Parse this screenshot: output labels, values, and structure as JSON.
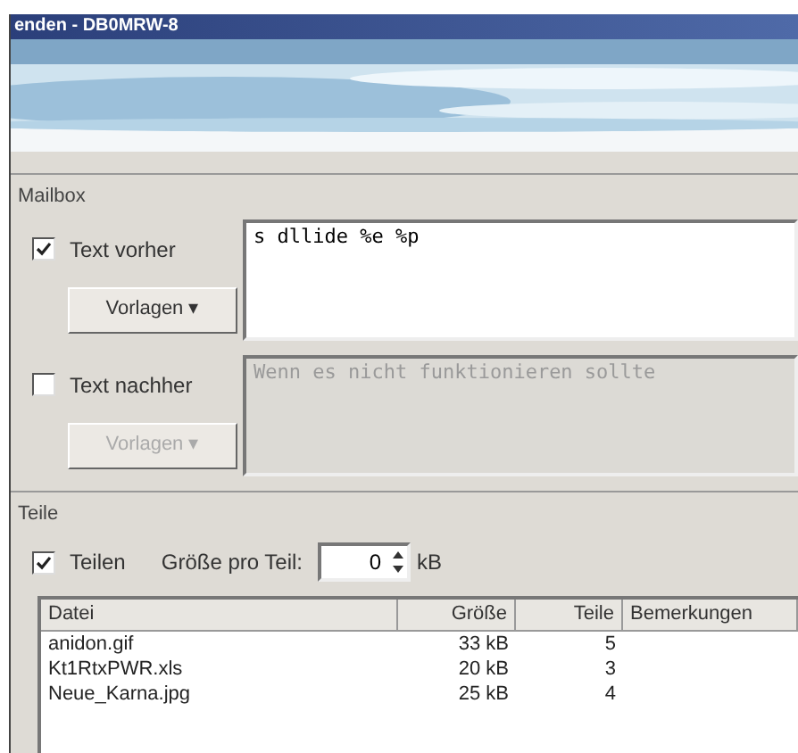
{
  "window": {
    "title": "enden - DB0MRW-8"
  },
  "mailbox": {
    "label": "Mailbox",
    "before": {
      "label": "Text vorher",
      "checked": true,
      "button": "Vorlagen ▾",
      "value": "s dllide %e %p"
    },
    "after": {
      "label": "Text nachher",
      "checked": false,
      "button": "Vorlagen ▾",
      "value": "Wenn es nicht funktionieren sollte"
    }
  },
  "parts": {
    "label": "Teile",
    "split": {
      "label": "Teilen",
      "checked": true
    },
    "size_label": "Größe pro Teil:",
    "size_value": "0",
    "size_unit": "kB",
    "table": {
      "columns": [
        "Datei",
        "Größe",
        "Teile",
        "Bemerkungen"
      ],
      "rows": [
        [
          "anidon.gif",
          "33 kB",
          "5"
        ],
        [
          "Kt1RtxPWR.xls",
          "20 kB",
          "3"
        ],
        [
          "Neue_Karna.jpg",
          "25 kB",
          "4"
        ]
      ]
    }
  }
}
